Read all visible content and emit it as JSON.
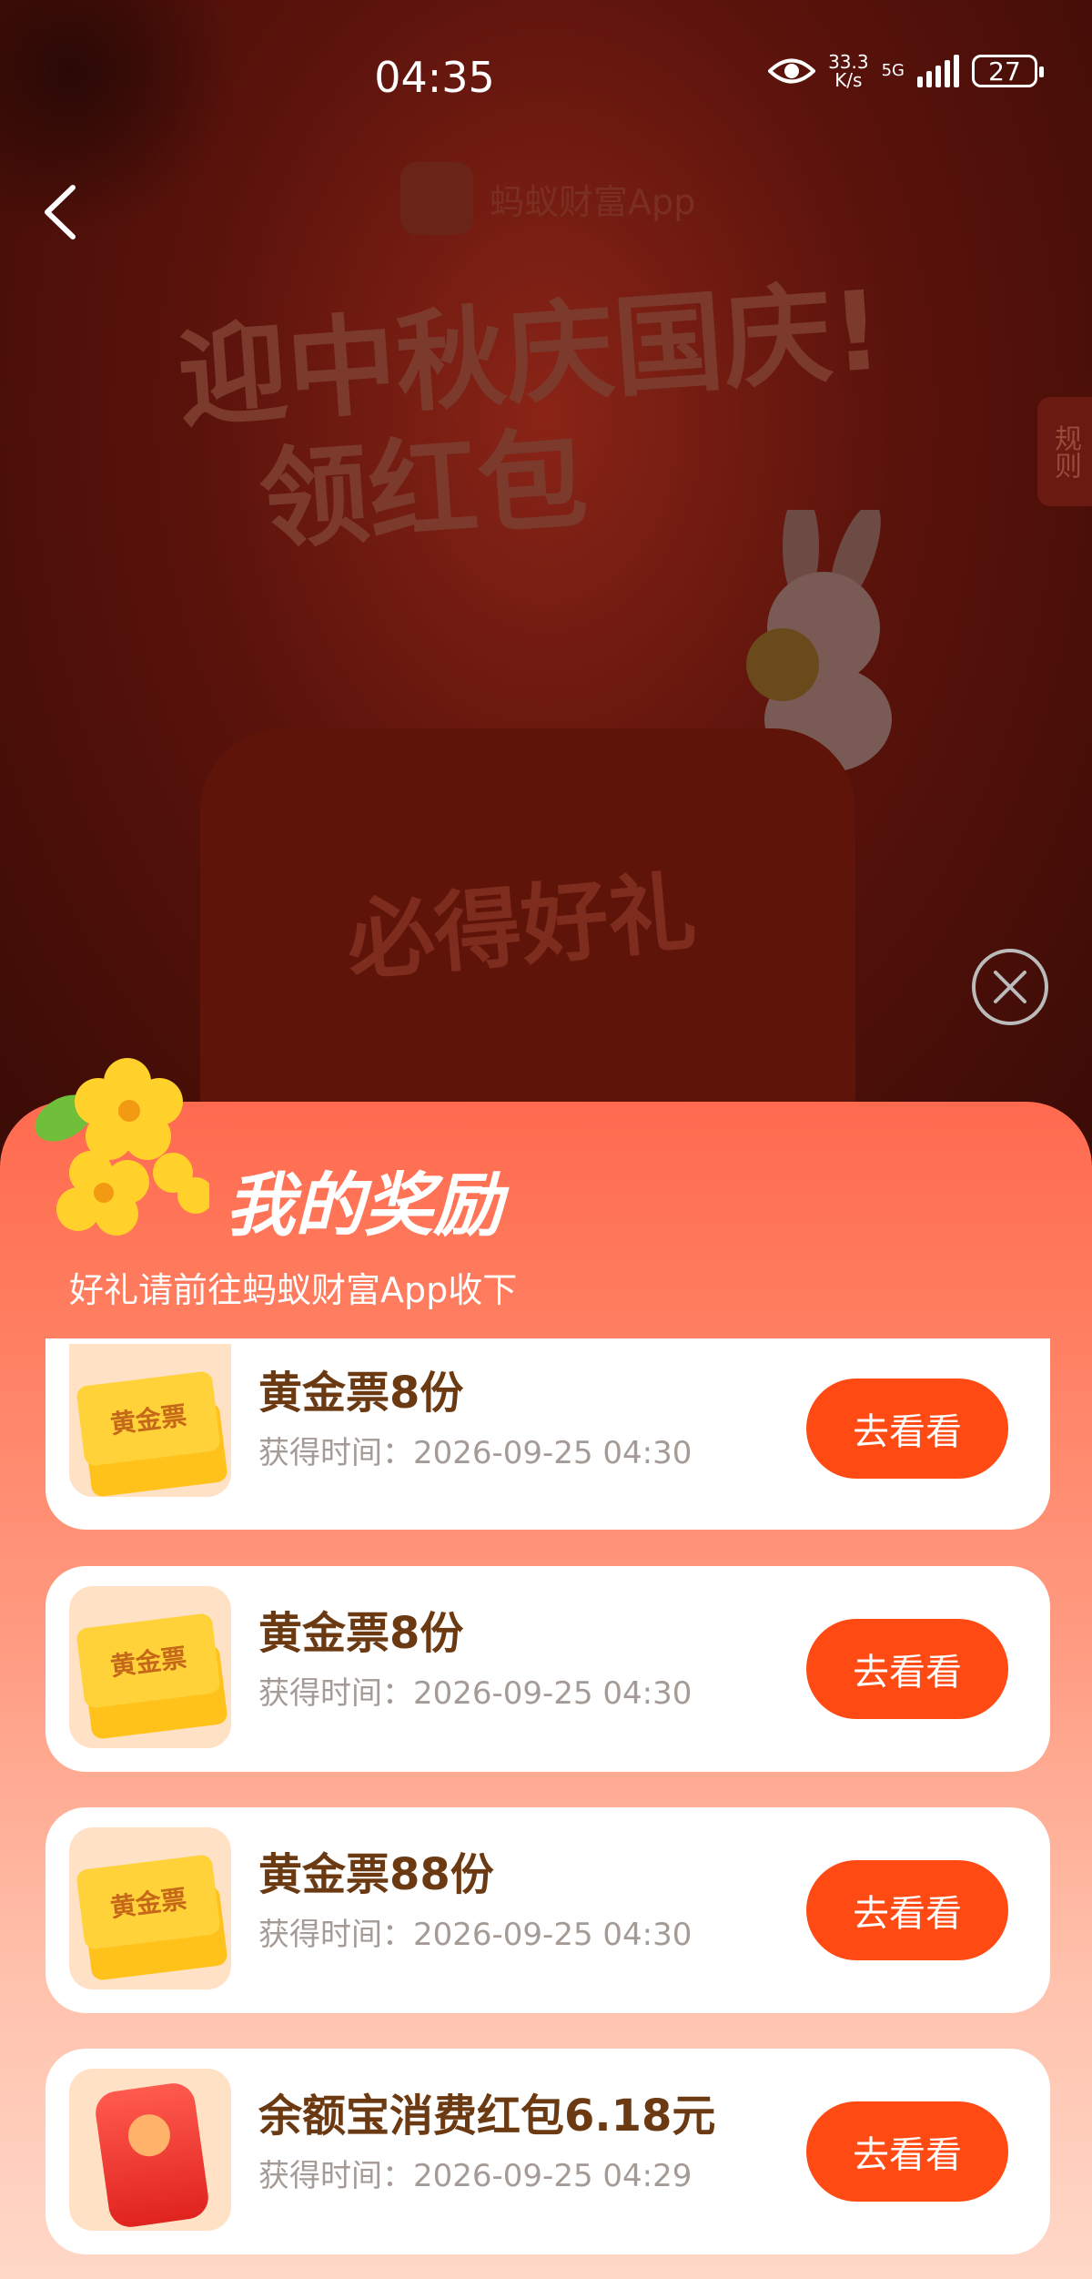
{
  "status_bar": {
    "time": "04:35",
    "speed_value": "33.3",
    "speed_unit": "K/s",
    "network": "5G",
    "battery": "27"
  },
  "brand": {
    "name": "蚂蚁财富App"
  },
  "headline": {
    "line1": "迎中秋庆国庆!",
    "line2": "领红包"
  },
  "rules_tab": "规则",
  "gift_box": {
    "label": "必得好礼"
  },
  "sheet": {
    "title": "我的奖励",
    "subtitle": "好礼请前往蚂蚁财富App收下"
  },
  "rewards": [
    {
      "title": "黄金票8份",
      "time": "获得时间：2026-09-25 04:30",
      "button": "去看看",
      "thumb_label": "黄金票"
    },
    {
      "title": "黄金票8份",
      "time": "获得时间：2026-09-25 04:30",
      "button": "去看看",
      "thumb_label": "黄金票"
    },
    {
      "title": "黄金票88份",
      "time": "获得时间：2026-09-25 04:30",
      "button": "去看看",
      "thumb_label": "黄金票"
    },
    {
      "title": "余额宝消费红包6.18元",
      "time": "获得时间：2026-09-25 04:29",
      "button": "去看看",
      "thumb_label": ""
    }
  ],
  "colors": {
    "accent": "#ff4a14",
    "title_brown": "#6b3a12",
    "sheet_top": "#ff6a4f"
  }
}
